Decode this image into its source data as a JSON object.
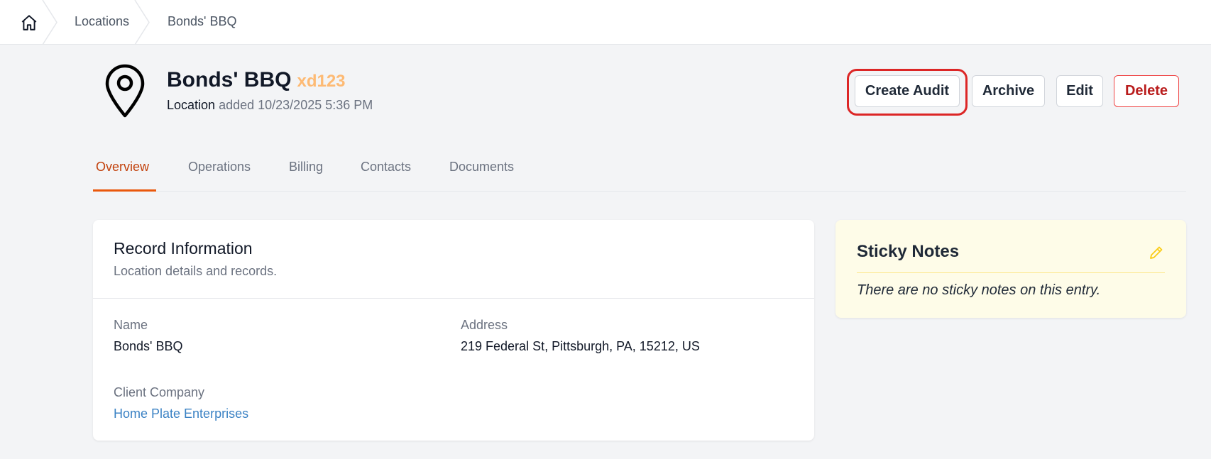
{
  "breadcrumb": {
    "home_icon": "home-icon",
    "items": [
      {
        "label": "Locations"
      },
      {
        "label": "Bonds' BBQ"
      }
    ]
  },
  "header": {
    "icon": "map-pin-icon",
    "title": "Bonds' BBQ",
    "code": "xd123",
    "subtitle_label": "Location",
    "subtitle_text": "added 10/23/2025 5:36 PM"
  },
  "actions": {
    "create_audit": "Create Audit",
    "archive": "Archive",
    "edit": "Edit",
    "delete": "Delete"
  },
  "tabs": [
    {
      "label": "Overview",
      "active": true
    },
    {
      "label": "Operations",
      "active": false
    },
    {
      "label": "Billing",
      "active": false
    },
    {
      "label": "Contacts",
      "active": false
    },
    {
      "label": "Documents",
      "active": false
    }
  ],
  "record": {
    "title": "Record Information",
    "description": "Location details and records.",
    "name_label": "Name",
    "name_value": "Bonds' BBQ",
    "address_label": "Address",
    "address_value": "219 Federal St, Pittsburgh, PA, 15212, US",
    "client_label": "Client Company",
    "client_value": "Home Plate Enterprises"
  },
  "sticky_notes": {
    "title": "Sticky Notes",
    "edit_icon": "pencil-icon",
    "empty_text": "There are no sticky notes on this entry."
  },
  "colors": {
    "accent": "#ea580c",
    "code": "#fdba74",
    "delete": "#b91c1c",
    "link": "#3b82c4",
    "highlight": "#dc2626",
    "sticky_bg": "#fefce8"
  }
}
